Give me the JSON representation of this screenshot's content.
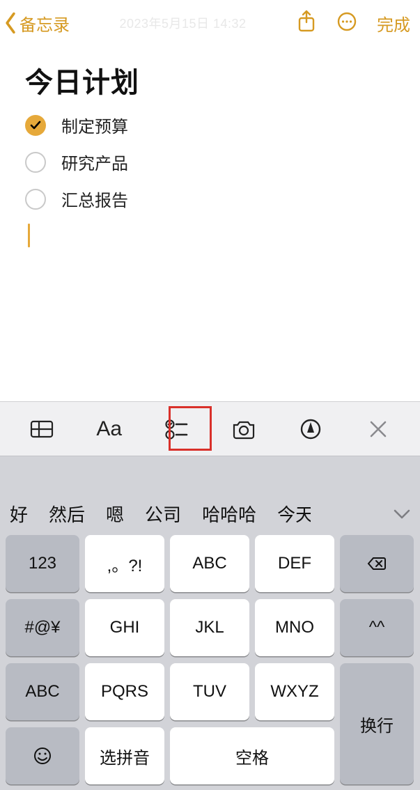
{
  "nav": {
    "back_label": "备忘录",
    "timestamp": "2023年5月15日 14:32",
    "done_label": "完成"
  },
  "note": {
    "title": "今日计划",
    "items": [
      {
        "text": "制定预算",
        "checked": true
      },
      {
        "text": "研究产品",
        "checked": false
      },
      {
        "text": "汇总报告",
        "checked": false
      }
    ]
  },
  "toolbar": {
    "format_label": "Aa"
  },
  "keyboard": {
    "suggestions": [
      "好",
      "然后",
      "嗯",
      "公司",
      "哈哈哈",
      "今天"
    ],
    "keys": {
      "num": "123",
      "punct": ",。?!",
      "abc": "ABC",
      "def": "DEF",
      "sym": "#@¥",
      "ghi": "GHI",
      "jkl": "JKL",
      "mno": "MNO",
      "face": "^^",
      "abc2": "ABC",
      "pqrs": "PQRS",
      "tuv": "TUV",
      "wxyz": "WXYZ",
      "select": "选拼音",
      "space": "空格",
      "enter": "换行"
    }
  }
}
